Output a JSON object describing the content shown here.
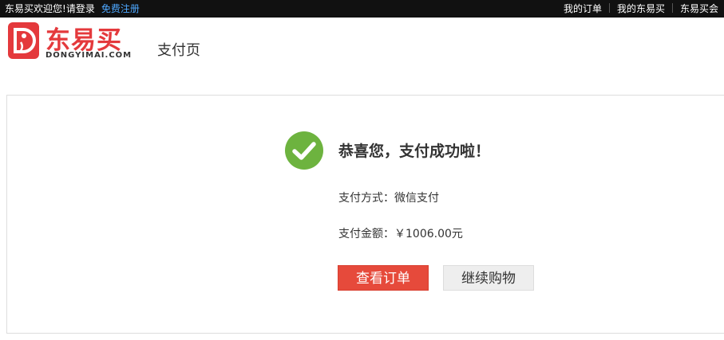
{
  "topbar": {
    "welcome": "东易买欢迎您!",
    "login": "请登录",
    "register": "免费注册",
    "links": [
      "我的订单",
      "我的东易买",
      "东易买会"
    ]
  },
  "logo": {
    "name": "东易买",
    "subtitle": "DONGYIMAI.COM"
  },
  "page": {
    "title": "支付页"
  },
  "result": {
    "title": "恭喜您，支付成功啦！",
    "method_label": "支付方式：",
    "method_value": "微信支付",
    "amount_label": "支付金额：",
    "amount_value": "￥1006.00元"
  },
  "buttons": {
    "view_order": "查看订单",
    "continue_shopping": "继续购物"
  },
  "colors": {
    "brand": "#e4393c",
    "success": "#6db33f",
    "primary_button": "#e64a3b",
    "link": "#4ea8ff"
  }
}
